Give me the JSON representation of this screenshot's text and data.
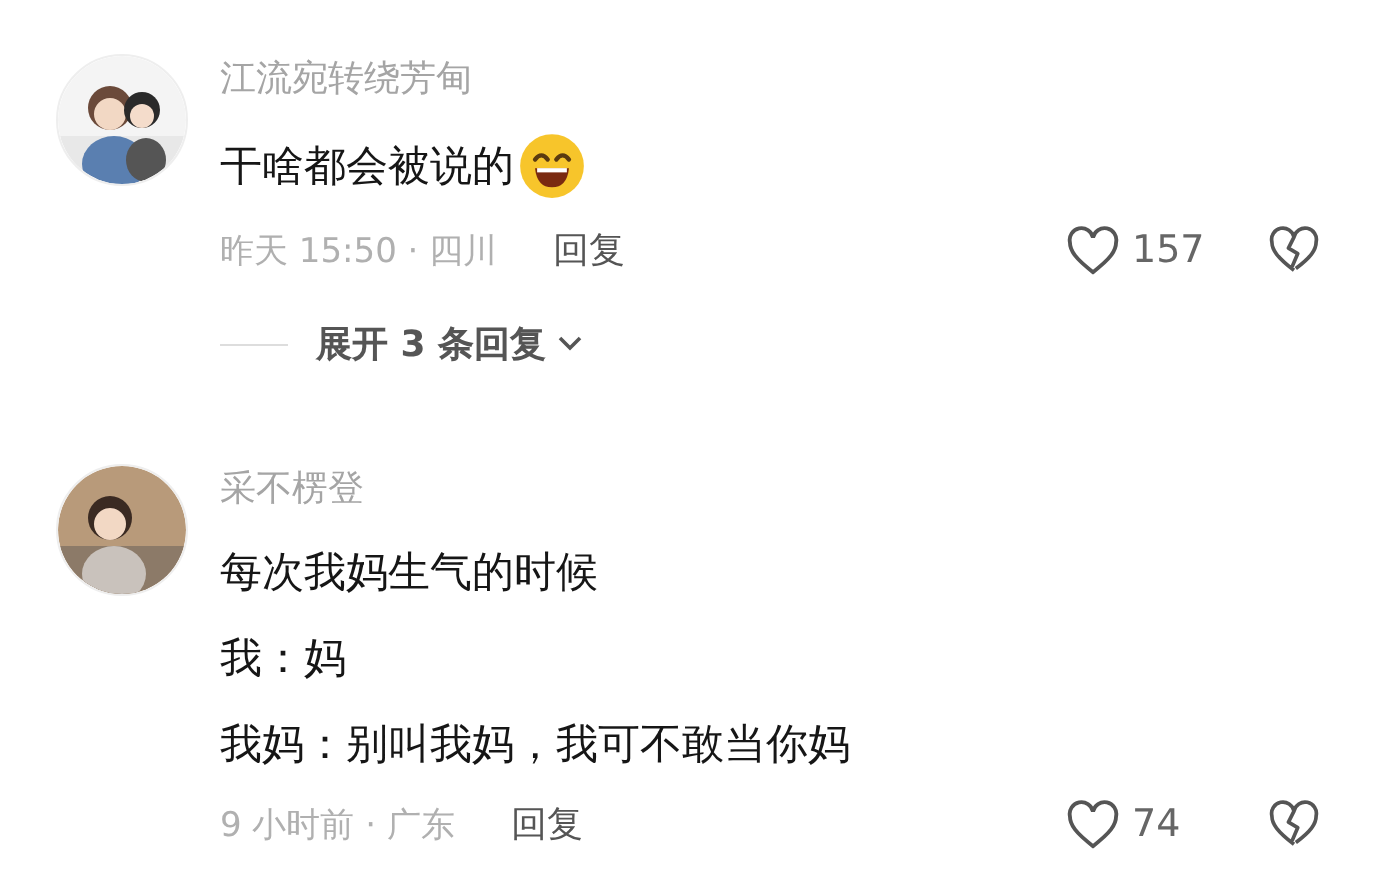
{
  "comments": [
    {
      "author": "江流宛转绕芳甸",
      "lines": [
        "干啥都会被说的"
      ],
      "trailing_emoji": true,
      "time_place": "昨天 15:50 · 四川",
      "reply": "回复",
      "likes": "157",
      "expand": "展开 3 条回复"
    },
    {
      "author": "采不楞登",
      "lines": [
        "每次我妈生气的时候",
        "我：妈",
        "我妈：别叫我妈，我可不敢当你妈"
      ],
      "trailing_emoji": false,
      "time_place": "9 小时前 · 广东",
      "reply": "回复",
      "likes": "74"
    }
  ]
}
